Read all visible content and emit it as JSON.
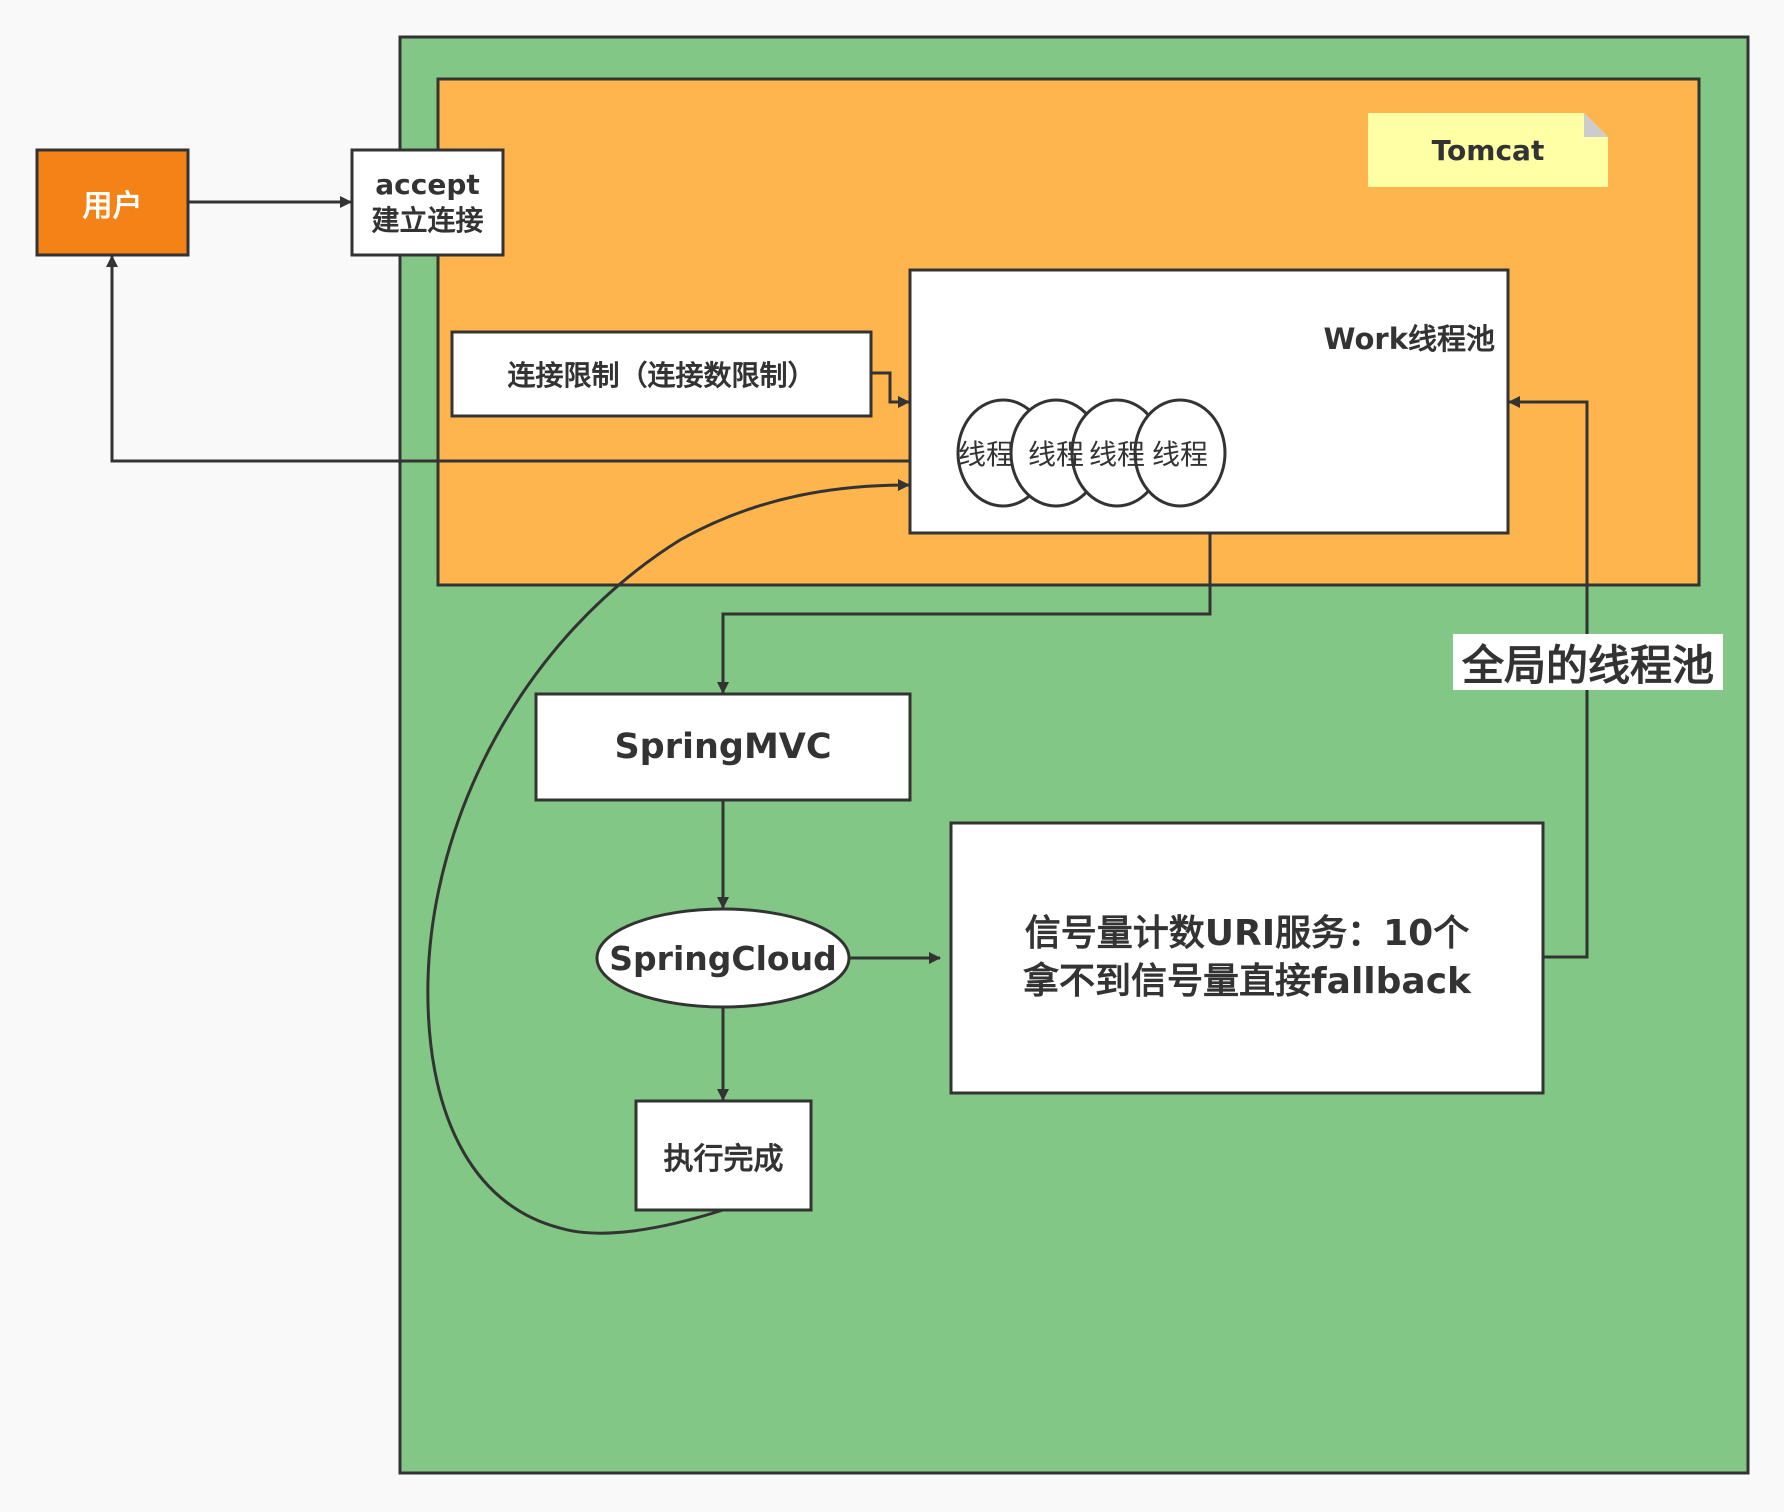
{
  "colors": {
    "background": "#f9f9f9",
    "app_container": "#82c785",
    "tomcat_container": "#ffb54d",
    "note": "#ffffa6",
    "user_node": "#f58216",
    "stroke": "#333333",
    "node_fill": "#ffffff"
  },
  "nodes": {
    "user": "用户",
    "accept_line1": "accept",
    "accept_line2": "建立连接",
    "tomcat_note": "Tomcat",
    "connection_limit": "连接限制（连接数限制）",
    "work_pool_title": "Work线程池",
    "threads": [
      "线程",
      "线程",
      "线程",
      "线程"
    ],
    "spring_mvc": "SpringMVC",
    "spring_cloud": "SpringCloud",
    "done": "执行完成",
    "semaphore_line1": "信号量计数URI服务：10个",
    "semaphore_line2": "拿不到信号量直接fallback",
    "global_pool_label": "全局的线程池"
  },
  "edges": [
    {
      "from": "user",
      "to": "accept"
    },
    {
      "from": "connection_limit",
      "to": "work_pool"
    },
    {
      "from": "work_pool",
      "to": "user"
    },
    {
      "from": "work_pool",
      "to": "spring_mvc"
    },
    {
      "from": "spring_mvc",
      "to": "spring_cloud"
    },
    {
      "from": "spring_cloud",
      "to": "semaphore"
    },
    {
      "from": "spring_cloud",
      "to": "done"
    },
    {
      "from": "done",
      "to": "work_pool"
    },
    {
      "from": "semaphore",
      "to": "work_pool",
      "label": "全局的线程池"
    }
  ]
}
